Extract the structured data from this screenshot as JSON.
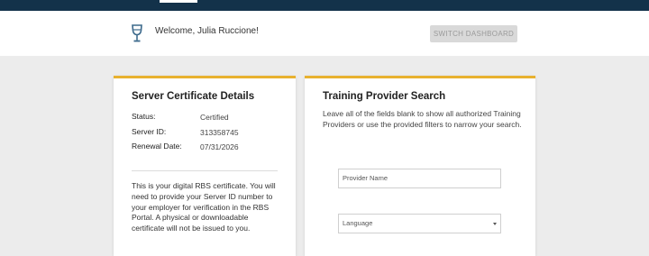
{
  "header": {
    "welcome_text": "Welcome, Julia Ruccione!",
    "switch_button_label": "SWITCH DASHBOARD",
    "icon": "wine-glass-icon"
  },
  "certificate": {
    "title": "Server Certificate Details",
    "rows": [
      {
        "label": "Status:",
        "value": "Certified"
      },
      {
        "label": "Server ID:",
        "value": "313358745"
      },
      {
        "label": "Renewal Date:",
        "value": "07/31/2026"
      }
    ],
    "note": "This is your digital RBS certificate. You will need to provide your Server ID number to your employer for verification in the RBS Portal. A physical or downloadable certificate will not be issued to you."
  },
  "search": {
    "title": "Training Provider Search",
    "description": "Leave all of the fields blank to show all authorized Training Providers or use the provided filters to narrow your search.",
    "provider_placeholder": "Provider Name",
    "language_selected": "Language"
  },
  "colors": {
    "topbar": "#13324a",
    "card_accent": "#e8b12f",
    "icon": "#3d6a8c"
  }
}
